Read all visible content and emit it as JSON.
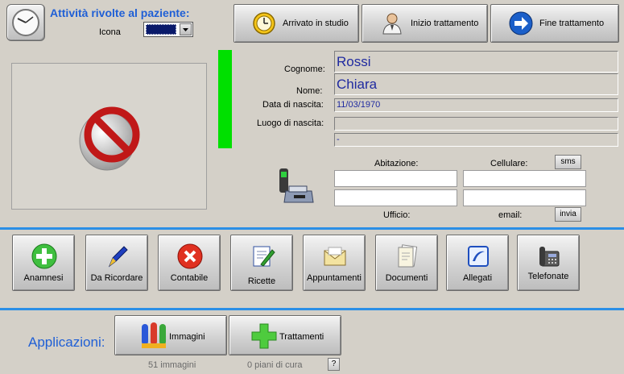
{
  "header": {
    "title": "Attività rivolte al paziente:",
    "icon_label": "Icona"
  },
  "top_buttons": {
    "arrived": "Arrivato in studio",
    "start": "Inizio trattamento",
    "end": "Fine trattamento"
  },
  "patient": {
    "surname_label": "Cognome:",
    "surname": "Rossi",
    "name_label": "Nome:",
    "name": "Chiara",
    "dob_label": "Data di nascita:",
    "dob": "11/03/1970",
    "birthplace_label": "Luogo di nascita:",
    "birthplace": "",
    "extra": "-"
  },
  "contacts": {
    "home_label": "Abitazione:",
    "mobile_label": "Cellulare:",
    "sms_button": "sms",
    "office_label": "Ufficio:",
    "email_label": "email:",
    "send_button": "invia",
    "home": "",
    "mobile": "",
    "office": "",
    "email": ""
  },
  "actions": {
    "anamnesi": "Anamnesi",
    "da_ricordare": "Da Ricordare",
    "contabile": "Contabile",
    "ricette": "Ricette",
    "appuntamenti": "Appuntamenti",
    "documenti": "Documenti",
    "allegati": "Allegati",
    "telefonate": "Telefonate"
  },
  "applications": {
    "label": "Applicazioni:",
    "images_button": "Immagini",
    "images_count": "51 immagini",
    "treatments_button": "Trattamenti",
    "treatments_count": "0 piani di cura",
    "help": "?"
  },
  "colors": {
    "accent_blue": "#2b8fe6",
    "status_green": "#00e000",
    "field_text": "#1f2aa0"
  },
  "icons": [
    "clock-icon",
    "color-swatch-icon",
    "alarm-clock-icon",
    "doctor-icon",
    "arrow-right-icon",
    "no-photo-icon",
    "phone-fax-icon",
    "plus-icon",
    "pen-icon",
    "cancel-icon",
    "prescription-icon",
    "envelope-icon",
    "documents-icon",
    "attachment-icon",
    "telephone-icon",
    "tubes-icon",
    "green-cross-icon"
  ]
}
